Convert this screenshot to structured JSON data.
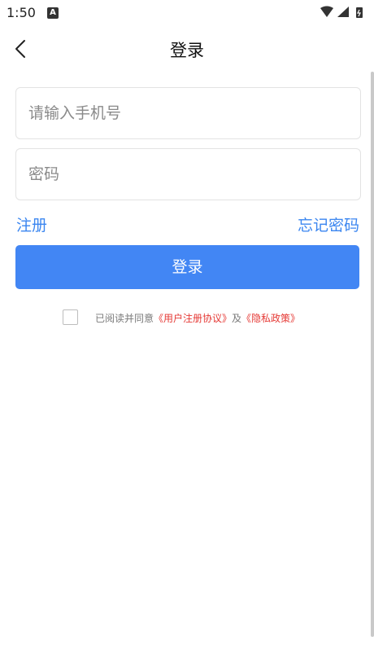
{
  "status_bar": {
    "time": "1:50",
    "badge": "A"
  },
  "nav": {
    "title": "登录",
    "back_icon": "chevron-left-icon"
  },
  "form": {
    "phone_placeholder": "请输入手机号",
    "password_placeholder": "密码",
    "register_label": "注册",
    "forgot_label": "忘记密码",
    "login_label": "登录"
  },
  "agreement": {
    "prefix": "已阅读并同意",
    "user_agreement": "《用户注册协议》",
    "and": "及",
    "privacy_policy": "《隐私政策》"
  },
  "colors": {
    "accent": "#4286f4",
    "link": "#3b86f0",
    "agreement_link": "#e53935"
  }
}
